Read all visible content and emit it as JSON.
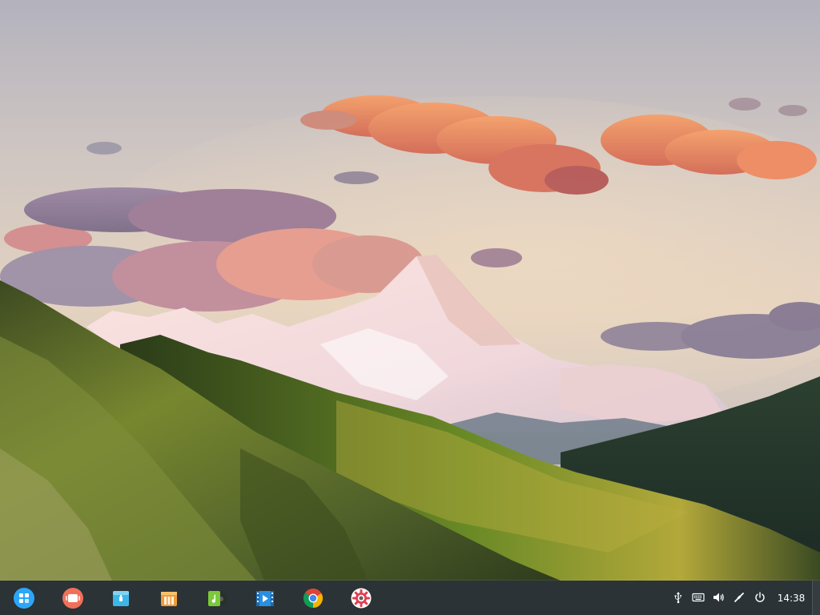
{
  "dock": {
    "launcher": {
      "label": "Launcher",
      "icon": "launcher-grid-icon",
      "color": "#2ca7f8"
    },
    "apps": [
      {
        "id": "multitasking-view",
        "icon": "multitasking-icon",
        "color": "#f0705a"
      },
      {
        "id": "file-manager",
        "icon": "file-manager-icon",
        "color": "#3fb6e8"
      },
      {
        "id": "app-store",
        "icon": "app-store-icon",
        "color": "#f29a38"
      },
      {
        "id": "music",
        "icon": "music-icon",
        "color": "#7cc93a"
      },
      {
        "id": "movie",
        "icon": "movie-icon",
        "color": "#2b8fe0"
      },
      {
        "id": "chrome",
        "icon": "chrome-icon",
        "color": "#db4437"
      },
      {
        "id": "control-center",
        "icon": "settings-gear-icon",
        "color": "#e04050"
      }
    ]
  },
  "tray": {
    "icons": [
      "usb-icon",
      "keyboard-icon",
      "volume-icon",
      "network-icon",
      "power-icon"
    ],
    "clock": "14:38"
  }
}
